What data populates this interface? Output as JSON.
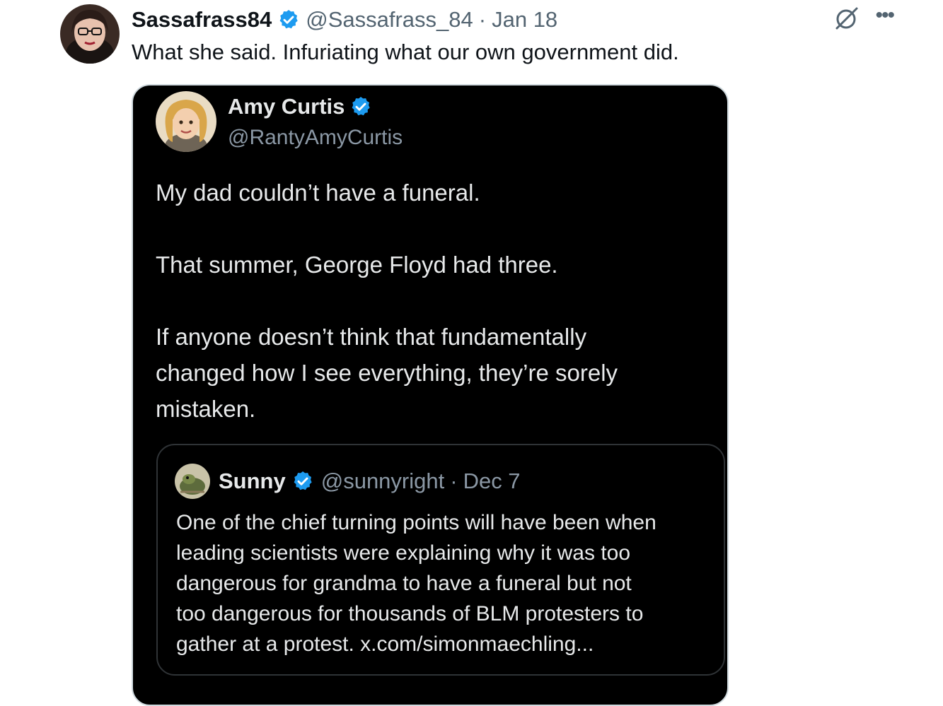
{
  "tweet": {
    "author_name": "Sassafrass84",
    "handle": "@Sassafrass_84",
    "separator": "·",
    "date": "Jan 18",
    "text": "What she said. Infuriating what our own government did."
  },
  "quoted": {
    "author_name": "Amy Curtis",
    "handle": "@RantyAmyCurtis",
    "paragraphs": [
      "My dad couldn’t have a funeral.",
      "That summer, George Floyd had three.",
      "If anyone doesn’t think that fundamentally",
      "changed how I see everything, they’re sorely",
      "mistaken."
    ],
    "inner_quote": {
      "author_name": "Sunny",
      "handle": "@sunnyright",
      "separator": "·",
      "date": "Dec 7",
      "lines": [
        "One of the chief turning points will have been when",
        "leading scientists were explaining why it was too",
        "dangerous for grandma to have a funeral but not",
        "too dangerous for thousands of BLM protesters to",
        "gather at a protest. x.com/simonmaechling..."
      ]
    }
  },
  "icons": {
    "verified": "verified-badge-icon",
    "grok": "grok-icon",
    "more": "more-options-icon"
  },
  "colors": {
    "verified_blue": "#1d9bf0",
    "text_primary": "#0f1419",
    "text_secondary": "#536471"
  }
}
